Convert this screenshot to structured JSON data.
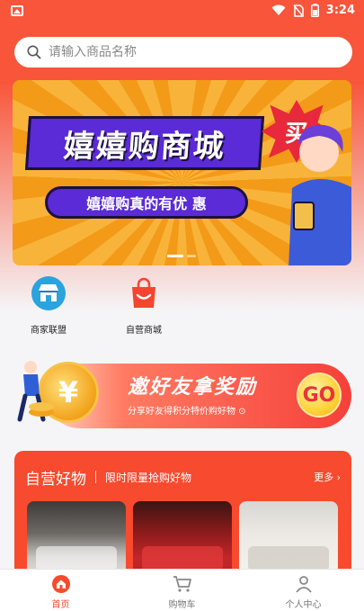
{
  "status_bar": {
    "time": "3:24"
  },
  "search": {
    "placeholder": "请输入商品名称"
  },
  "banner": {
    "title": "嬉嬉购商城",
    "badge": "买",
    "subtitle": "嬉嬉购真的有优 惠",
    "slide_count": 2,
    "active_slide": 1
  },
  "categories": [
    {
      "label": "商家联盟",
      "icon": "shop-icon"
    },
    {
      "label": "自营商城",
      "icon": "shopping-bag-icon"
    }
  ],
  "invite": {
    "title": "邀好友拿奖励",
    "subtitle": "分享好友得积分特价购好物 ⊙",
    "coin_symbol": "¥",
    "go_label": "GO"
  },
  "self_run": {
    "title": "自营好物",
    "tagline": "限时限量抢购好物",
    "more_label": "更多 ›"
  },
  "tabbar": {
    "items": [
      {
        "label": "首页",
        "icon": "home-icon",
        "active": true
      },
      {
        "label": "购物车",
        "icon": "cart-icon",
        "active": false
      },
      {
        "label": "个人中心",
        "icon": "user-icon",
        "active": false
      }
    ]
  },
  "colors": {
    "brand_red": "#f74a2e",
    "banner_purple": "#5a2bd6",
    "banner_orange": "#f6a21c"
  }
}
